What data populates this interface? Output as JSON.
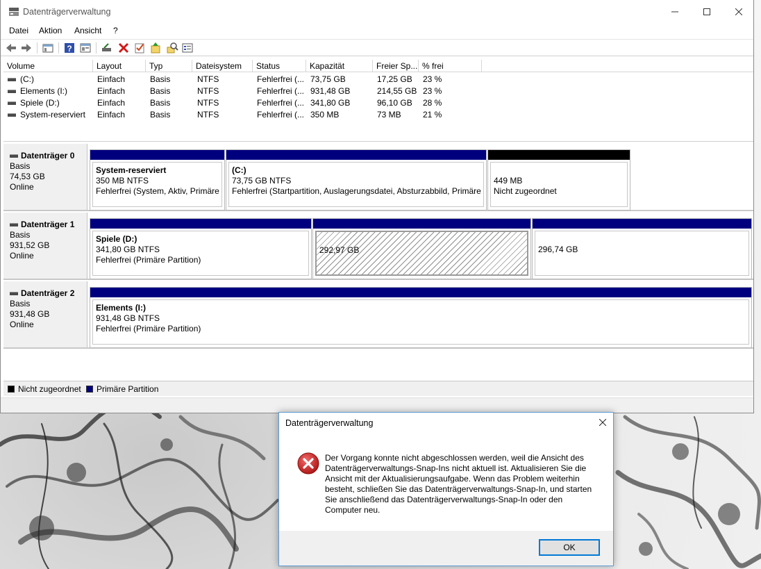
{
  "window": {
    "title": "Datenträgerverwaltung",
    "icons": [
      "app-icon",
      "minimize-icon",
      "maximize-icon",
      "close-icon"
    ]
  },
  "menu": [
    "Datei",
    "Aktion",
    "Ansicht",
    "?"
  ],
  "toolbar": {
    "icons": [
      "back-icon",
      "forward-icon",
      "console-tree-icon",
      "help-icon",
      "properties-icon",
      "connect-drive-icon",
      "delete-icon",
      "check-icon",
      "format-icon",
      "search-icon",
      "settings-icon"
    ]
  },
  "volume_list": {
    "columns": [
      "Volume",
      "Layout",
      "Typ",
      "Dateisystem",
      "Status",
      "Kapazität",
      "Freier Sp...",
      "% frei"
    ],
    "rows": [
      [
        "(C:)",
        "Einfach",
        "Basis",
        "NTFS",
        "Fehlerfrei (...",
        "73,75 GB",
        "17,25 GB",
        "23 %"
      ],
      [
        "Elements (I:)",
        "Einfach",
        "Basis",
        "NTFS",
        "Fehlerfrei (...",
        "931,48 GB",
        "214,55 GB",
        "23 %"
      ],
      [
        "Spiele (D:)",
        "Einfach",
        "Basis",
        "NTFS",
        "Fehlerfrei (...",
        "341,80 GB",
        "96,10 GB",
        "28 %"
      ],
      [
        "System-reserviert",
        "Einfach",
        "Basis",
        "NTFS",
        "Fehlerfrei (...",
        "350 MB",
        "73 MB",
        "21 %"
      ]
    ]
  },
  "disks": [
    {
      "name": "Datenträger 0",
      "type": "Basis",
      "size": "74,53 GB",
      "state": "Online",
      "partitions": [
        {
          "title": "System-reserviert",
          "size": "350 MB NTFS",
          "status": "Fehlerfrei (System, Aktiv, Primäre P",
          "kind": "primary"
        },
        {
          "title": "(C:)",
          "size": "73,75 GB NTFS",
          "status": "Fehlerfrei (Startpartition, Auslagerungsdatei, Absturzabbild, Primäre P",
          "kind": "primary"
        },
        {
          "title": "",
          "size": "449 MB",
          "status": "Nicht zugeordnet",
          "kind": "unallocated"
        }
      ]
    },
    {
      "name": "Datenträger 1",
      "type": "Basis",
      "size": "931,52 GB",
      "state": "Online",
      "partitions": [
        {
          "title": "Spiele  (D:)",
          "size": "341,80 GB NTFS",
          "status": "Fehlerfrei (Primäre Partition)",
          "kind": "primary"
        },
        {
          "title": "",
          "size": "292,97 GB",
          "status": "",
          "kind": "primary-selected"
        },
        {
          "title": "",
          "size": "296,74 GB",
          "status": "",
          "kind": "primary"
        }
      ]
    },
    {
      "name": "Datenträger 2",
      "type": "Basis",
      "size": "931,48 GB",
      "state": "Online",
      "partitions": [
        {
          "title": "Elements  (I:)",
          "size": "931,48 GB NTFS",
          "status": "Fehlerfrei (Primäre Partition)",
          "kind": "primary"
        }
      ]
    }
  ],
  "legend": [
    {
      "label": "Nicht zugeordnet",
      "color": "#000000"
    },
    {
      "label": "Primäre Partition",
      "color": "#00007f"
    }
  ],
  "dialog": {
    "title": "Datenträgerverwaltung",
    "message": "Der Vorgang konnte nicht abgeschlossen werden, weil die Ansicht des Datenträgerverwaltungs-Snap-Ins nicht aktuell ist. Aktualisieren Sie die Ansicht mit der Aktualisierungsaufgabe. Wenn das Problem weiterhin besteht, schließen Sie das Datenträgerverwaltungs-Snap-In, und starten Sie anschließend das Datenträgerverwaltungs-Snap-In oder den Computer neu.",
    "ok_label": "OK",
    "icons": [
      "error-icon",
      "close-icon"
    ]
  },
  "colors": {
    "primary_partition": "#00007f",
    "unallocated": "#000000",
    "error_red": "#d42a2a",
    "focus_blue": "#0078d7"
  }
}
